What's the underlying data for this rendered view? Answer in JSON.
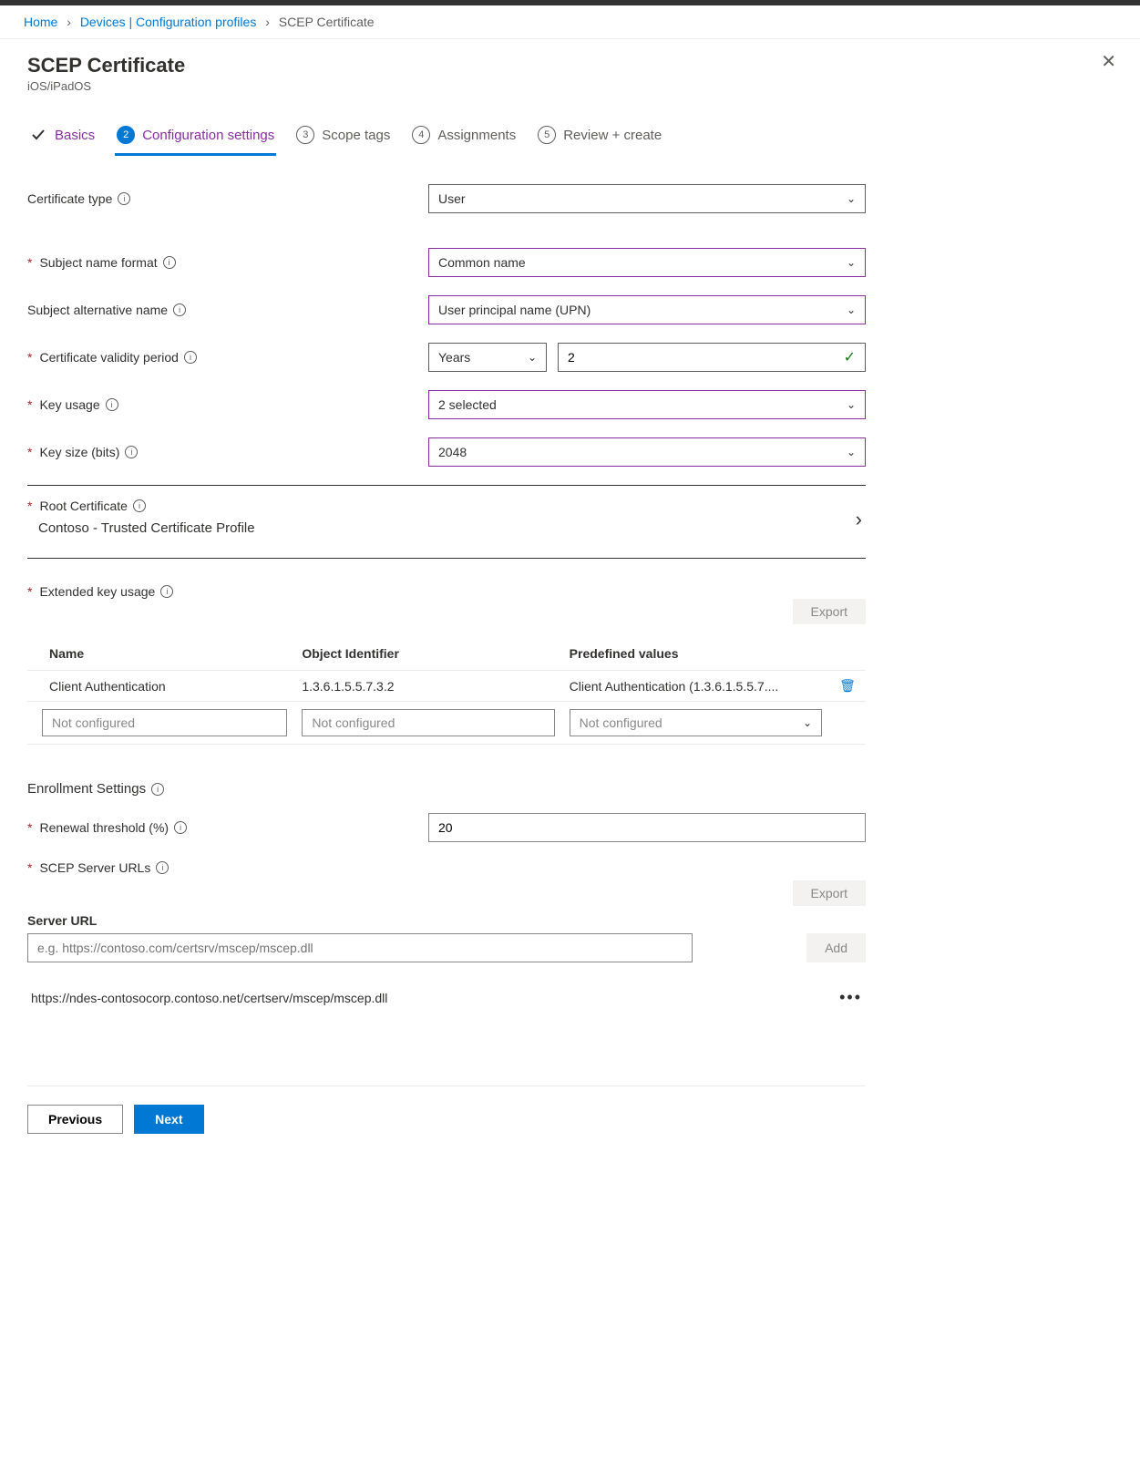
{
  "breadcrumb": {
    "home": "Home",
    "devices": "Devices | Configuration profiles",
    "current": "SCEP Certificate"
  },
  "header": {
    "title": "SCEP Certificate",
    "subtitle": "iOS/iPadOS"
  },
  "tabs": {
    "basics": "Basics",
    "config": "Configuration settings",
    "scope": "Scope tags",
    "assign": "Assignments",
    "review": "Review + create",
    "n3": "3",
    "n4": "4",
    "n5": "5",
    "n2": "2"
  },
  "labels": {
    "cert_type": "Certificate type",
    "subject_name_format": "Subject name format",
    "san": "Subject alternative name",
    "validity": "Certificate validity period",
    "key_usage": "Key usage",
    "key_size": "Key size (bits)",
    "root_cert": "Root Certificate",
    "eku": "Extended key usage",
    "enroll": "Enrollment Settings",
    "renewal": "Renewal threshold (%)",
    "scep_urls": "SCEP Server URLs",
    "server_url": "Server URL",
    "star": "*"
  },
  "values": {
    "cert_type": "User",
    "subject_name_format": "Common name",
    "san": "User principal name (UPN)",
    "validity_unit": "Years",
    "validity_value": "2",
    "key_usage": "2 selected",
    "key_size": "2048",
    "root_cert": "Contoso - Trusted Certificate Profile",
    "renewal": "20",
    "url_placeholder": "e.g. https://contoso.com/certsrv/mscep/mscep.dll",
    "url1": "https://ndes-contosocorp.contoso.net/certserv/mscep/mscep.dll"
  },
  "eku_table": {
    "hdr_name": "Name",
    "hdr_oid": "Object Identifier",
    "hdr_pred": "Predefined values",
    "row_name": "Client Authentication",
    "row_oid": "1.3.6.1.5.5.7.3.2",
    "row_pred": "Client Authentication (1.3.6.1.5.5.7....",
    "not_conf": "Not configured"
  },
  "buttons": {
    "export": "Export",
    "add": "Add",
    "previous": "Previous",
    "next": "Next"
  },
  "icons": {
    "info": "i",
    "chev_down": "⌄",
    "chev_right": "›",
    "check": "✓",
    "more": "•••",
    "close": "✕",
    "trash": "🗑"
  }
}
